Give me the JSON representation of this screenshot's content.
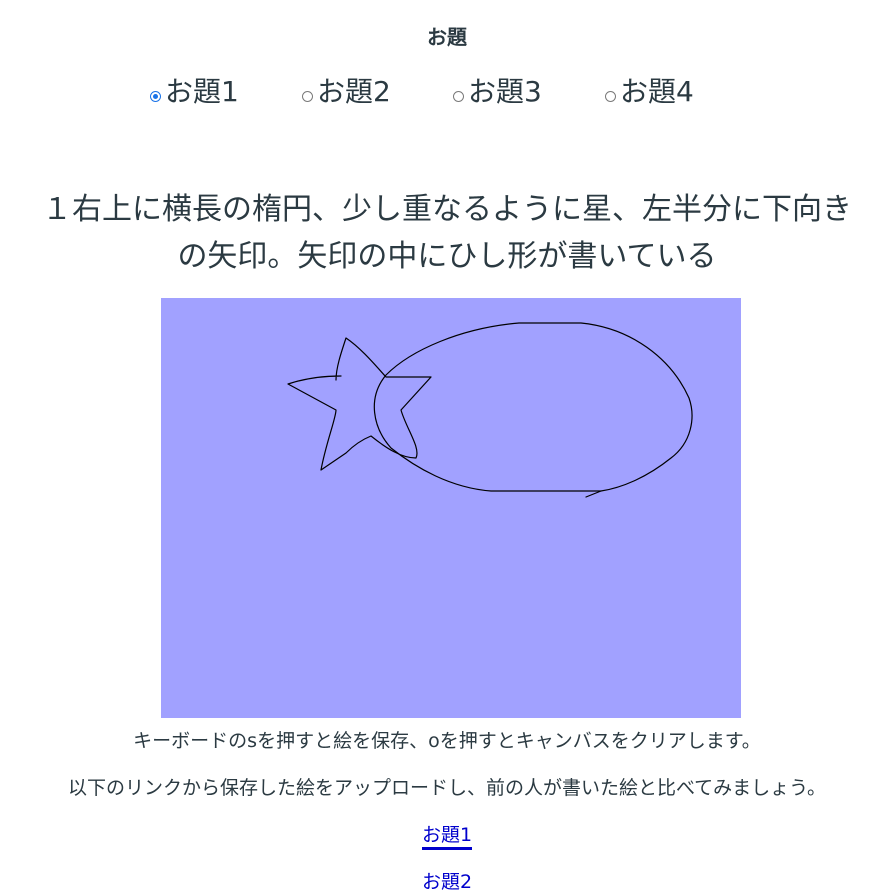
{
  "heading": "お題",
  "radios": [
    {
      "label": "お題1",
      "checked": true
    },
    {
      "label": "お題2",
      "checked": false
    },
    {
      "label": "お題3",
      "checked": false
    },
    {
      "label": "お題4",
      "checked": false
    }
  ],
  "prompt": {
    "line1": "１右上に横長の楕円、少し重なるように星、左半分に下向き",
    "line2": "の矢印。矢印の中にひし形が書いている"
  },
  "canvas": {
    "background": "#a1a1ff",
    "stroke_color": "#000000"
  },
  "instructions": {
    "line1": "キーボードのsを押すと絵を保存、oを押すとキャンバスをクリアします。",
    "line2": "以下のリンクから保存した絵をアップロードし、前の人が書いた絵と比べてみましょう。"
  },
  "links": [
    {
      "label": "お題1"
    },
    {
      "label": "お題2"
    }
  ],
  "colors": {
    "text": "#2b3a42",
    "link": "#0000cc",
    "radio_accent": "#1a73e8"
  }
}
